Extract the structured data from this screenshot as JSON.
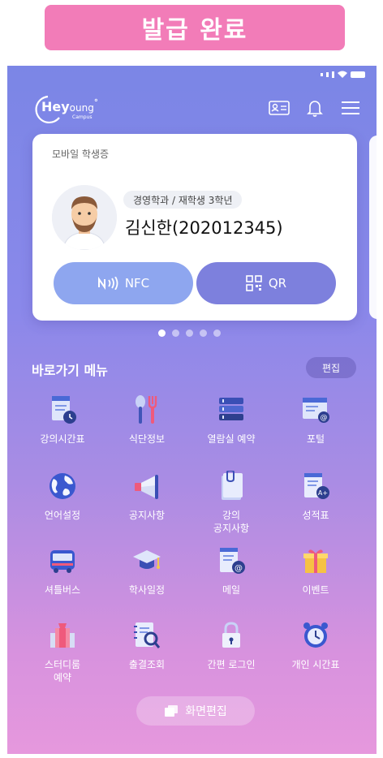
{
  "banner": {
    "text": "발급 완료"
  },
  "logo": {
    "brand_hey": "Hey",
    "brand_young": "oung",
    "sub": "Campus"
  },
  "card": {
    "title": "모바일 학생증",
    "department": "경영학과 / 재학생 3학년",
    "name": "김신한(202012345)",
    "nfc_label": "NFC",
    "qr_label": "QR"
  },
  "carousel": {
    "pages": 5,
    "active": 1
  },
  "shortcut": {
    "title": "바로가기 메뉴",
    "edit_label": "편집",
    "items": [
      {
        "label": "강의시간표",
        "icon": "timetable-icon"
      },
      {
        "label": "식단정보",
        "icon": "meal-icon"
      },
      {
        "label": "열람실 예약",
        "icon": "reading-room-icon"
      },
      {
        "label": "포털",
        "icon": "portal-icon"
      },
      {
        "label": "언어설정",
        "icon": "globe-icon"
      },
      {
        "label": "공지사항",
        "icon": "megaphone-icon"
      },
      {
        "label": "강의\n공지사항",
        "icon": "lecture-notice-icon"
      },
      {
        "label": "성적표",
        "icon": "grade-icon"
      },
      {
        "label": "셔틀버스",
        "icon": "bus-icon"
      },
      {
        "label": "학사일정",
        "icon": "graduation-cap-icon"
      },
      {
        "label": "메일",
        "icon": "mail-icon"
      },
      {
        "label": "이벤트",
        "icon": "gift-icon"
      },
      {
        "label": "스터디룸\n예약",
        "icon": "study-room-icon"
      },
      {
        "label": "출결조회",
        "icon": "attendance-icon"
      },
      {
        "label": "간편 로그인",
        "icon": "lock-icon"
      },
      {
        "label": "개인 시간표",
        "icon": "alarm-clock-icon"
      }
    ]
  },
  "footer": {
    "edit_screen_label": "화면편집"
  },
  "colors": {
    "banner": "#f27cb8",
    "gradient_top": "#7b86e6",
    "gradient_bottom": "#e698dd",
    "nfc": "#8ea6ef",
    "qr": "#7d80dd"
  }
}
